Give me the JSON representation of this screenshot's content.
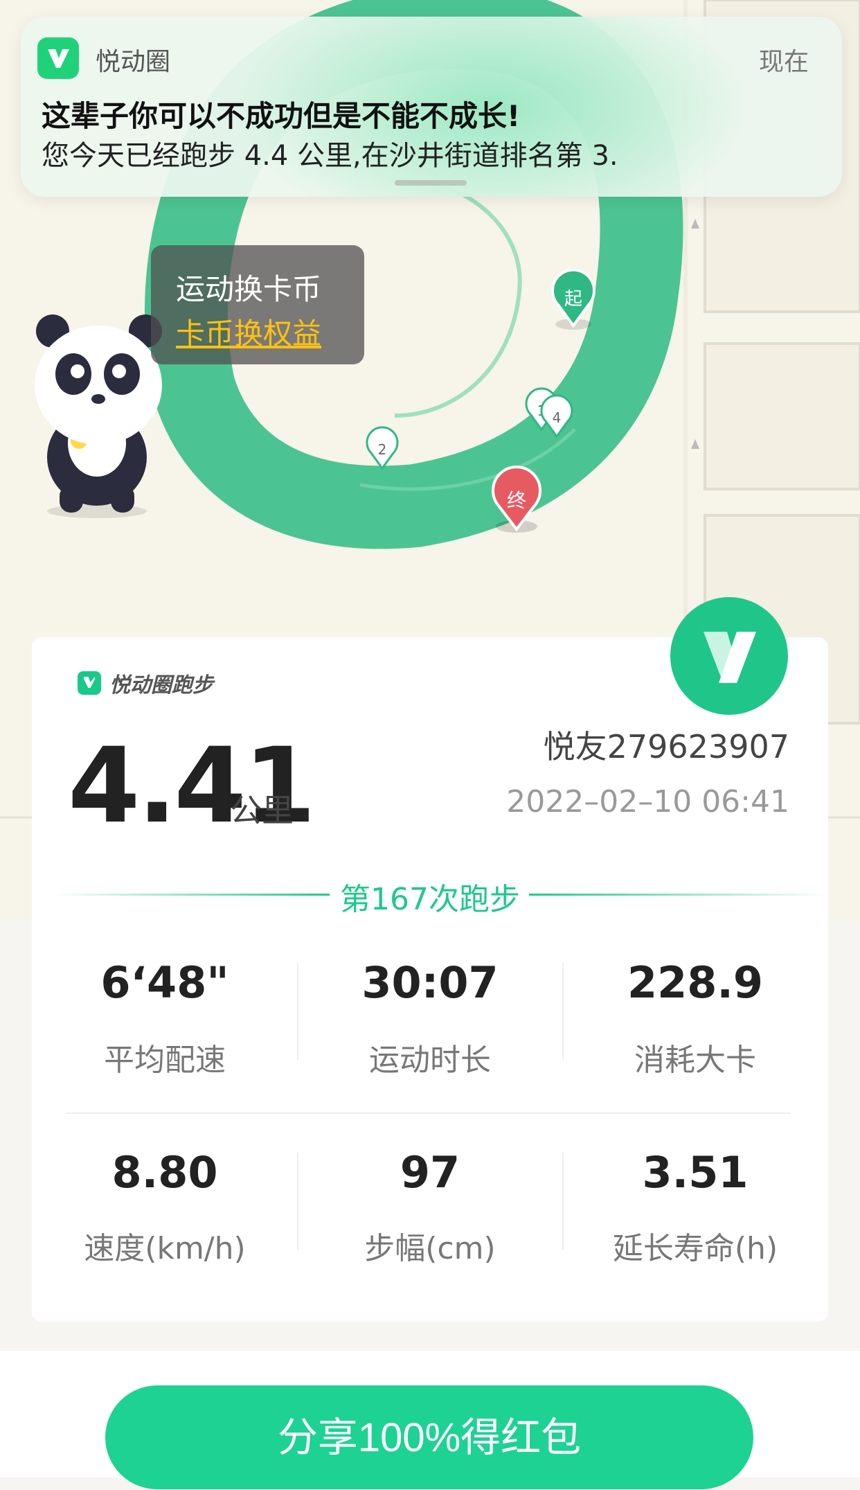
{
  "notification": {
    "app_name": "悦动圈",
    "time": "现在",
    "title": "这辈子你可以不成功但是不能不成长!",
    "body": "您今天已经跑步 4.4 公里,在沙井街道排名第 3."
  },
  "map": {
    "bubble_line1": "运动换卡币",
    "bubble_line2": "卡币换权益",
    "markers": {
      "start": "起",
      "end": "终",
      "km1": "1",
      "km2": "2",
      "km4": "4"
    }
  },
  "card": {
    "brand": "悦动圈跑步",
    "distance": "4.41",
    "distance_unit": "公里",
    "user": "悦友279623907",
    "datetime": "2022–02–10 06:41",
    "run_count": "第167次跑步",
    "stats": [
      {
        "value": "6‘48\"",
        "label": "平均配速"
      },
      {
        "value": "30:07",
        "label": "运动时长"
      },
      {
        "value": "228.9",
        "label": "消耗大卡"
      },
      {
        "value": "8.80",
        "label": "速度(km/h)"
      },
      {
        "value": "97",
        "label": "步幅(cm)"
      },
      {
        "value": "3.51",
        "label": "延长寿命(h)"
      }
    ]
  },
  "share_button": "分享100%得红包",
  "colors": {
    "accent": "#1ed293",
    "route": "#3fc48e",
    "end_marker": "#e85a62"
  }
}
